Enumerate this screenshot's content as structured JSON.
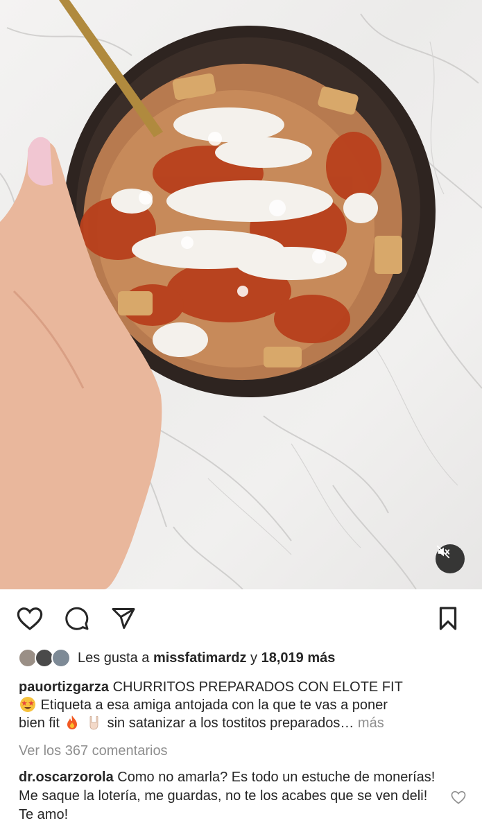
{
  "media": {
    "mute_icon": "speaker-muted-icon"
  },
  "actions": {
    "like_icon": "heart-icon",
    "comment_icon": "comment-icon",
    "share_icon": "send-icon",
    "save_icon": "bookmark-icon"
  },
  "likes": {
    "prefix": "Les gusta a ",
    "user": "missfatimardz",
    "connector": " y ",
    "count": "18,019 más"
  },
  "caption": {
    "username": "pauortizgarza",
    "title": "CHURRITOS PREPARADOS CON ELOTE FIT",
    "line2": " Etiqueta a esa amiga antojada con la que te vas a poner",
    "line3a": "bien fit ",
    "line3b": " sin satanizar a los tostitos preparados…",
    "more": "más"
  },
  "view_comments": "Ver los 367 comentarios",
  "comment": {
    "username": "dr.oscarzorola",
    "text": "Como no amarla? Es todo un estuche de monerías! Me saque la lotería, me guardas, no te los acabes que se ven deli! Te amo!"
  },
  "colors": {
    "text": "#262626",
    "muted": "#8e8e8e",
    "sauce": "#b8401c",
    "bowl": "#2e2420"
  }
}
